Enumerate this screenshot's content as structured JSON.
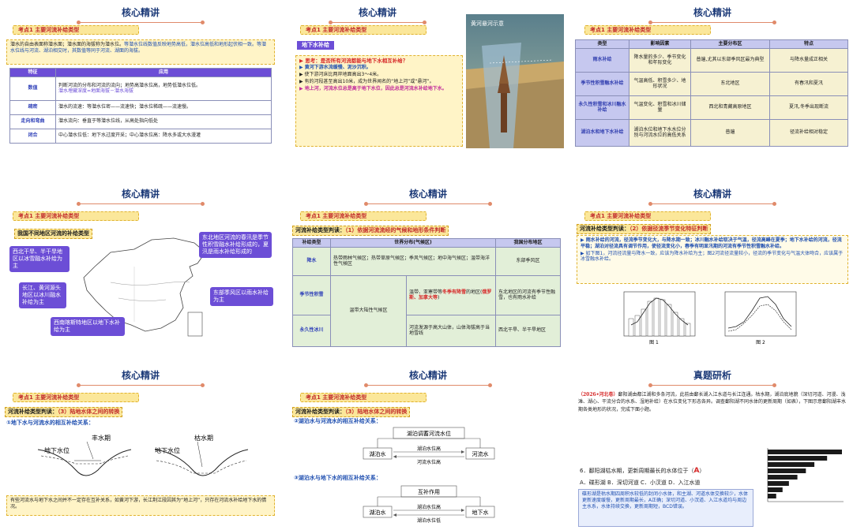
{
  "slides": {
    "s1": {
      "title": "核心精讲",
      "kbar": "考点1  主要河流补给类型",
      "intro_a": "潜水的自由表面称潜水面；潜水面的海拔称为潜水位。",
      "intro_b": "等潜水位线数值反映地势高低，潜水位高低和地形起伏相一致。等潜水位线与河流、湖泊相交时，其数值等同于河流、湖面的海拔。",
      "th": [
        "特征",
        "应用"
      ],
      "rows": [
        {
          "h": "数值",
          "a": "判断河流的分布和河流的流向；地势高潜水位高，地势低潜水位低。",
          "b": "潜水埋藏深度=地面海拔－潜水海拔"
        },
        {
          "h": "疏密",
          "a": "潜水的流速：等潜水位密——流速快；潜水位稀疏——流速慢。",
          "b": ""
        },
        {
          "h": "走向和弯曲",
          "a": "潜水流向：垂直于等潜水位线，从高处指向低处",
          "b": ""
        },
        {
          "h": "闭合",
          "a": "中心潜水位低：地下水过度开采；中心潜水位高：降水多或大水漫灌",
          "b": ""
        }
      ]
    },
    "s2": {
      "title": "核心精讲",
      "kbar": "考点1  主要河流补给类型",
      "tag": "地下水补给",
      "think": "思考：是否所有河流都能与地下水相互补给？",
      "l1": "黄河下游水流缓慢、泥沙沉积。",
      "l2": "使下游河床比两岸地面高出3～4米。",
      "l3": "有的河段甚至高出10米，成为世界闻名的“地上河”或“悬河”。",
      "l4": "地上河，河流水位总是高于地下水位，因此总是河流水补给地下水。",
      "photo_caption": "黄河悬河示意"
    },
    "s3": {
      "title": "核心精讲",
      "kbar": "考点1  主要河流补给类型",
      "th": [
        "类型",
        "影响因素",
        "主要分布区",
        "特点"
      ],
      "rows": [
        [
          "雨水补给",
          "降水量的多少、季节变化和年际变化",
          "普遍,尤其以东部季风区最为典型",
          "与降水量成正相关"
        ],
        [
          "季节性积雪融水补给",
          "气温高低、积雪多少、地形状况",
          "东北地区",
          "有春汛和夏汛"
        ],
        [
          "永久性积雪和冰川融水补给",
          "气温变化、积雪和冰川储量",
          "西北和青藏高原地区",
          "夏汛,冬季出现断流"
        ],
        [
          "湖泊水和地下水补给",
          "湖泊水位和地下水水位分别与河流水位的高低关系",
          "普遍",
          "径流补给相对稳定"
        ]
      ]
    },
    "s4": {
      "title": "核心精讲",
      "kbar": "考点1  主要河流补给类型",
      "sub": "我国不同地区河流的补给类型",
      "c1": "西北干旱、半干旱地区以冰雪融水补给为主",
      "c2": "长江、黄河源头地区以冰川融水补给为主",
      "c3": "西南喀斯特地区以地下水补给为主",
      "c4": "东北地区河流的春汛是季节性积雪融水补给形成的，夏汛是雨水补给形成的",
      "c5": "东部季风区以雨水补给为主"
    },
    "s5": {
      "title": "核心精讲",
      "kbar": "考点1  主要河流补给类型",
      "hdr_a": "河流补给类型判读：",
      "hdr_b": "（1）依据河流流经的气候和地形条件判断",
      "th": [
        "补给类型",
        "世界分布(气候区)",
        "我国分布地区"
      ],
      "r1": {
        "h": "降水",
        "a": "热带雨林气候区；热带草原气候区；季风气候区；地中海气候区；温带海洋性气候区",
        "b": "东部季风区"
      },
      "r2": {
        "h": "季节性积雪",
        "a": "温带大陆性气候区",
        "c_pre": "温带、亚寒带等",
        "c_red": "冬季有降雪",
        "c_mid": "的地区(",
        "c_red2": "俄罗斯、加拿大等",
        "c_end": ")",
        "b": "东北地区的河流有季节性融雪，也有雨水补给"
      },
      "r3": {
        "h": "永久性冰川",
        "c": "河流发源于高大山体，山体海拔高于当地雪线",
        "b": "西北干旱、半干旱地区"
      }
    },
    "s6": {
      "title": "核心精讲",
      "kbar": "考点1  主要河流补给类型",
      "hdr_a": "河流补给类型判读：",
      "hdr_b": "（2）依据径流季节变化特征判断",
      "p1": "雨水补给的河流，径流季节变化大，与降水期一致；冰川融水补给取决于气温，径流高峰在夏季；地下水补给的河流，径流平稳；湖泊对径流具有调节作用，使径流变化小，春季有明显汛期的河流有季节性积雪融水补给。",
      "p2": "如下图1，河流径流量与降水一致，应该为降水补给为主；图2河流径流量较小，径流的季节变化与气温大体吻合，应该属于冰雪融水补给。",
      "fig1": "图 1",
      "fig2": "图 2"
    },
    "s7": {
      "title": "核心精讲",
      "kbar": "考点1  主要河流补给类型",
      "hdr_a": "河流补给类型判读：",
      "hdr_b": "（3）陆地水体之间的转换",
      "sub": "①地下水与河流水的相互补给关系：",
      "wet": "丰水期",
      "dry": "枯水期",
      "wl1": "地下水位",
      "wl2": "地下水位",
      "note_a": "有些河流水与地下水之间并不一定存在互补关系，如黄河下游，长江荆江段因其为",
      "note_b": "“地上河”，只存在河流水补给地下水的情况。"
    },
    "s8": {
      "title": "核心精讲",
      "kbar": "考点1  主要河流补给类型",
      "hdr_a": "河流补给类型判读：",
      "hdr_b": "（3）陆地水体之间的转换",
      "sub2": "②湖泊水与河流水的相互补给关系：",
      "sub3": "③湖泊水与地下水的相互补给关系：",
      "box_top1": "湖泊调蓄河流水位",
      "lake": "湖泊水",
      "river": "河流水",
      "arrow_up1": "湖泊水位高",
      "arrow_dn1": "河流水位高",
      "box_top2": "互补作用",
      "lake2": "湖泊水",
      "ground": "地下水",
      "arrow_up2": "湖泊水位高",
      "arrow_dn2": "湖泊水位低"
    },
    "s9": {
      "title": "真题研析",
      "q_tag": "（2026•河北卷）",
      "q_text": "鄱阳湖由都江湖和多条河流，此前由鄱长湖入江水道与长江连通。枯水期，湖泊底地貌（深切河道、河漫、浅滩、湖心、干流分合的水系、湿地补给）在水位变化下形态各异。调查鄱阳湖不同水体的更新周期（如表），下图示意鄱阳湖丰水期各类地形的状况，完成下面小题。",
      "q6": "6．鄱阳湖枯水期，更新周期最长的水体位于（",
      "ans": "A",
      "q6_end": "）",
      "opts": "A．碟形湖  B．深切河道  C．小汊道  D．入江水道",
      "exp": "碟形湖是枯水期四周积水较低的封闭小水体，和主湖、河道水体交换较少，水体更新速度缓慢，更新周期最长，A正确；深切河道、小汊道、入江水道均与周边主水系，水体持续交换，更新周期短，BCD错误。",
      "chart_data": {
        "type": "bar",
        "orientation": "horizontal",
        "categories": [
          "",
          "",
          "",
          "",
          "",
          "",
          "",
          ""
        ],
        "values": [
          35,
          28,
          22,
          18,
          14,
          10,
          7,
          4
        ],
        "xlim": [
          0,
          35
        ]
      }
    }
  }
}
